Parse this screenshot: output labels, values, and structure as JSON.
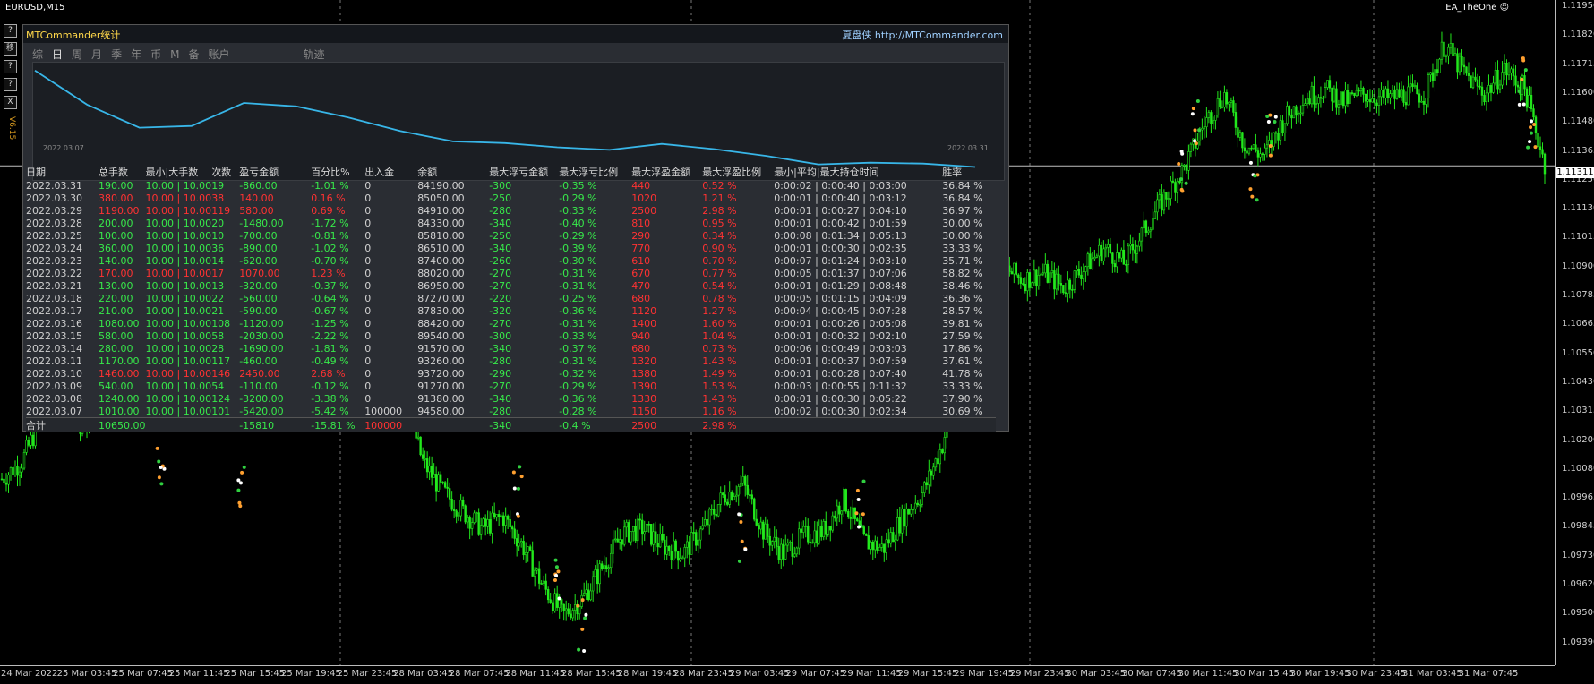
{
  "symbol": "EURUSD,M15",
  "ea_name": "EA_TheOne",
  "ea_icon": "smiley-icon",
  "colors": {
    "profit": "#37e84a",
    "loss": "#ff3232",
    "candle": "#22e81c",
    "equity": "#38b6e8"
  },
  "current_price": "1.11311",
  "price_axis": [
    "1.11950",
    "1.11820",
    "1.11715",
    "1.11600",
    "1.11480",
    "1.11365",
    "1.11250",
    "1.11130",
    "1.11015",
    "1.10900",
    "1.10785",
    "1.10665",
    "1.10550",
    "1.10430",
    "1.10315",
    "1.10200",
    "1.10080",
    "1.09965",
    "1.09845",
    "1.09730",
    "1.09620",
    "1.09500",
    "1.09390"
  ],
  "time_axis": [
    "24 Mar 2022",
    "25 Mar 03:45",
    "25 Mar 07:45",
    "25 Mar 11:45",
    "25 Mar 15:45",
    "25 Mar 19:45",
    "25 Mar 23:45",
    "28 Mar 03:45",
    "28 Mar 07:45",
    "28 Mar 11:45",
    "28 Mar 15:45",
    "28 Mar 19:45",
    "28 Mar 23:45",
    "29 Mar 03:45",
    "29 Mar 07:45",
    "29 Mar 11:45",
    "29 Mar 15:45",
    "29 Mar 19:45",
    "29 Mar 23:45",
    "30 Mar 03:45",
    "30 Mar 07:45",
    "30 Mar 11:45",
    "30 Mar 15:45",
    "30 Mar 19:45",
    "30 Mar 23:45",
    "31 Mar 03:45",
    "31 Mar 07:45"
  ],
  "candle_series": [
    1.1005,
    1.1012,
    1.103,
    1.104,
    1.1025,
    1.1036,
    1.1052,
    1.106,
    1.1058,
    1.1053,
    1.107,
    1.1095,
    1.1108,
    1.1095,
    1.1083,
    1.11,
    1.108,
    1.107,
    1.1074,
    1.105,
    1.1041,
    1.1012,
    1.1,
    1.0992,
    1.0985,
    1.099,
    1.0978,
    1.0962,
    1.095,
    1.0957,
    1.097,
    1.0983,
    1.0985,
    1.0978,
    1.0975,
    1.0985,
    1.0998,
    1.1003,
    1.0984,
    1.0975,
    1.0982,
    1.0984,
    1.0997,
    1.098,
    1.0977,
    1.099,
    1.1,
    1.102,
    1.107,
    1.1085,
    1.109,
    1.1085,
    1.1088,
    1.1082,
    1.109,
    1.1098,
    1.1092,
    1.1105,
    1.1118,
    1.113,
    1.1148,
    1.116,
    1.114,
    1.1135,
    1.115,
    1.1158,
    1.1162,
    1.1157,
    1.116,
    1.1158,
    1.116,
    1.116,
    1.118,
    1.1168,
    1.116,
    1.117,
    1.1162,
    1.1132
  ],
  "panel": {
    "title": "MTCommander统计",
    "link": "夏盘侠 http://MTCommander.com",
    "version": "V6.15",
    "side_buttons": [
      "?",
      "移",
      "?",
      "?",
      "X"
    ],
    "tabs": [
      "综",
      "日",
      "周",
      "月",
      "季",
      "年",
      "币",
      "M",
      "备",
      "账户",
      "轨迹"
    ],
    "active_tab": "日",
    "equity_start": "2022.03.07",
    "equity_end": "2022.03.31",
    "equity_curve": [
      93.2,
      89.2,
      86.5,
      86.7,
      89.4,
      89.0,
      87.7,
      86.1,
      84.9,
      84.7,
      84.2,
      83.9,
      84.6,
      84.0,
      83.2,
      82.2,
      82.4,
      82.3,
      81.9
    ],
    "columns": [
      "日期",
      "总手数",
      "最小|大手数",
      "次数",
      "盈亏金额",
      "百分比%",
      "出入金",
      "余额",
      "最大浮亏金额",
      "最大浮亏比例",
      "最大浮盈金额",
      "最大浮盈比例",
      "最小|平均|最大持仓时间",
      "胜率"
    ],
    "rows": [
      {
        "date": "2022.03.31",
        "lots": "190.00",
        "minmax": "10.00 | 10.00",
        "count": "19",
        "pnl": "-860.00",
        "pct": "-1.01 %",
        "io": "0",
        "bal": "84190.00",
        "fl": "-300",
        "flp": "-0.35 %",
        "fp": "440",
        "fpp": "0.52 %",
        "time": "0:00:02 | 0:00:40 | 0:03:00",
        "win": "36.84 %",
        "c": "g"
      },
      {
        "date": "2022.03.30",
        "lots": "380.00",
        "minmax": "10.00 | 10.00",
        "count": "38",
        "pnl": "140.00",
        "pct": "0.16 %",
        "io": "0",
        "bal": "85050.00",
        "fl": "-250",
        "flp": "-0.29 %",
        "fp": "1020",
        "fpp": "1.21 %",
        "time": "0:00:01 | 0:00:40 | 0:03:12",
        "win": "36.84 %",
        "c": "r"
      },
      {
        "date": "2022.03.29",
        "lots": "1190.00",
        "minmax": "10.00 | 10.00",
        "count": "119",
        "pnl": "580.00",
        "pct": "0.69 %",
        "io": "0",
        "bal": "84910.00",
        "fl": "-280",
        "flp": "-0.33 %",
        "fp": "2500",
        "fpp": "2.98 %",
        "time": "0:00:01 | 0:00:27 | 0:04:10",
        "win": "36.97 %",
        "c": "r"
      },
      {
        "date": "2022.03.28",
        "lots": "200.00",
        "minmax": "10.00 | 10.00",
        "count": "20",
        "pnl": "-1480.00",
        "pct": "-1.72 %",
        "io": "0",
        "bal": "84330.00",
        "fl": "-340",
        "flp": "-0.40 %",
        "fp": "810",
        "fpp": "0.95 %",
        "time": "0:00:01 | 0:00:42 | 0:01:59",
        "win": "30.00 %",
        "c": "g"
      },
      {
        "date": "2022.03.25",
        "lots": "100.00",
        "minmax": "10.00 | 10.00",
        "count": "10",
        "pnl": "-700.00",
        "pct": "-0.81 %",
        "io": "0",
        "bal": "85810.00",
        "fl": "-250",
        "flp": "-0.29 %",
        "fp": "290",
        "fpp": "0.34 %",
        "time": "0:00:08 | 0:01:34 | 0:05:13",
        "win": "30.00 %",
        "c": "g"
      },
      {
        "date": "2022.03.24",
        "lots": "360.00",
        "minmax": "10.00 | 10.00",
        "count": "36",
        "pnl": "-890.00",
        "pct": "-1.02 %",
        "io": "0",
        "bal": "86510.00",
        "fl": "-340",
        "flp": "-0.39 %",
        "fp": "770",
        "fpp": "0.90 %",
        "time": "0:00:01 | 0:00:30 | 0:02:35",
        "win": "33.33 %",
        "c": "g"
      },
      {
        "date": "2022.03.23",
        "lots": "140.00",
        "minmax": "10.00 | 10.00",
        "count": "14",
        "pnl": "-620.00",
        "pct": "-0.70 %",
        "io": "0",
        "bal": "87400.00",
        "fl": "-260",
        "flp": "-0.30 %",
        "fp": "610",
        "fpp": "0.70 %",
        "time": "0:00:07 | 0:01:24 | 0:03:10",
        "win": "35.71 %",
        "c": "g"
      },
      {
        "date": "2022.03.22",
        "lots": "170.00",
        "minmax": "10.00 | 10.00",
        "count": "17",
        "pnl": "1070.00",
        "pct": "1.23 %",
        "io": "0",
        "bal": "88020.00",
        "fl": "-270",
        "flp": "-0.31 %",
        "fp": "670",
        "fpp": "0.77 %",
        "time": "0:00:05 | 0:01:37 | 0:07:06",
        "win": "58.82 %",
        "c": "r"
      },
      {
        "date": "2022.03.21",
        "lots": "130.00",
        "minmax": "10.00 | 10.00",
        "count": "13",
        "pnl": "-320.00",
        "pct": "-0.37 %",
        "io": "0",
        "bal": "86950.00",
        "fl": "-270",
        "flp": "-0.31 %",
        "fp": "470",
        "fpp": "0.54 %",
        "time": "0:00:01 | 0:01:29 | 0:08:48",
        "win": "38.46 %",
        "c": "g"
      },
      {
        "date": "2022.03.18",
        "lots": "220.00",
        "minmax": "10.00 | 10.00",
        "count": "22",
        "pnl": "-560.00",
        "pct": "-0.64 %",
        "io": "0",
        "bal": "87270.00",
        "fl": "-220",
        "flp": "-0.25 %",
        "fp": "680",
        "fpp": "0.78 %",
        "time": "0:00:05 | 0:01:15 | 0:04:09",
        "win": "36.36 %",
        "c": "g"
      },
      {
        "date": "2022.03.17",
        "lots": "210.00",
        "minmax": "10.00 | 10.00",
        "count": "21",
        "pnl": "-590.00",
        "pct": "-0.67 %",
        "io": "0",
        "bal": "87830.00",
        "fl": "-320",
        "flp": "-0.36 %",
        "fp": "1120",
        "fpp": "1.27 %",
        "time": "0:00:04 | 0:00:45 | 0:07:28",
        "win": "28.57 %",
        "c": "g"
      },
      {
        "date": "2022.03.16",
        "lots": "1080.00",
        "minmax": "10.00 | 10.00",
        "count": "108",
        "pnl": "-1120.00",
        "pct": "-1.25 %",
        "io": "0",
        "bal": "88420.00",
        "fl": "-270",
        "flp": "-0.31 %",
        "fp": "1400",
        "fpp": "1.60 %",
        "time": "0:00:01 | 0:00:26 | 0:05:08",
        "win": "39.81 %",
        "c": "g"
      },
      {
        "date": "2022.03.15",
        "lots": "580.00",
        "minmax": "10.00 | 10.00",
        "count": "58",
        "pnl": "-2030.00",
        "pct": "-2.22 %",
        "io": "0",
        "bal": "89540.00",
        "fl": "-300",
        "flp": "-0.33 %",
        "fp": "940",
        "fpp": "1.04 %",
        "time": "0:00:01 | 0:00:32 | 0:02:10",
        "win": "27.59 %",
        "c": "g"
      },
      {
        "date": "2022.03.14",
        "lots": "280.00",
        "minmax": "10.00 | 10.00",
        "count": "28",
        "pnl": "-1690.00",
        "pct": "-1.81 %",
        "io": "0",
        "bal": "91570.00",
        "fl": "-340",
        "flp": "-0.37 %",
        "fp": "680",
        "fpp": "0.73 %",
        "time": "0:00:06 | 0:00:49 | 0:03:03",
        "win": "17.86 %",
        "c": "g"
      },
      {
        "date": "2022.03.11",
        "lots": "1170.00",
        "minmax": "10.00 | 10.00",
        "count": "117",
        "pnl": "-460.00",
        "pct": "-0.49 %",
        "io": "0",
        "bal": "93260.00",
        "fl": "-280",
        "flp": "-0.31 %",
        "fp": "1320",
        "fpp": "1.43 %",
        "time": "0:00:01 | 0:00:37 | 0:07:59",
        "win": "37.61 %",
        "c": "g"
      },
      {
        "date": "2022.03.10",
        "lots": "1460.00",
        "minmax": "10.00 | 10.00",
        "count": "146",
        "pnl": "2450.00",
        "pct": "2.68 %",
        "io": "0",
        "bal": "93720.00",
        "fl": "-290",
        "flp": "-0.32 %",
        "fp": "1380",
        "fpp": "1.49 %",
        "time": "0:00:01 | 0:00:28 | 0:07:40",
        "win": "41.78 %",
        "c": "r"
      },
      {
        "date": "2022.03.09",
        "lots": "540.00",
        "minmax": "10.00 | 10.00",
        "count": "54",
        "pnl": "-110.00",
        "pct": "-0.12 %",
        "io": "0",
        "bal": "91270.00",
        "fl": "-270",
        "flp": "-0.29 %",
        "fp": "1390",
        "fpp": "1.53 %",
        "time": "0:00:03 | 0:00:55 | 0:11:32",
        "win": "33.33 %",
        "c": "g"
      },
      {
        "date": "2022.03.08",
        "lots": "1240.00",
        "minmax": "10.00 | 10.00",
        "count": "124",
        "pnl": "-3200.00",
        "pct": "-3.38 %",
        "io": "0",
        "bal": "91380.00",
        "fl": "-340",
        "flp": "-0.36 %",
        "fp": "1330",
        "fpp": "1.43 %",
        "time": "0:00:01 | 0:00:30 | 0:05:22",
        "win": "37.90 %",
        "c": "g"
      },
      {
        "date": "2022.03.07",
        "lots": "1010.00",
        "minmax": "10.00 | 10.00",
        "count": "101",
        "pnl": "-5420.00",
        "pct": "-5.42 %",
        "io": "100000",
        "bal": "94580.00",
        "fl": "-280",
        "flp": "-0.28 %",
        "fp": "1150",
        "fpp": "1.16 %",
        "time": "0:00:02 | 0:00:30 | 0:02:34",
        "win": "30.69 %",
        "c": "g"
      }
    ],
    "total": {
      "label": "合计",
      "lots": "10650.00",
      "pnl": "-15810",
      "pct": "-15.81 %",
      "io": "100000",
      "fl": "-340",
      "flp": "-0.4 %",
      "fp": "2500",
      "fpp": "2.98 %"
    }
  }
}
